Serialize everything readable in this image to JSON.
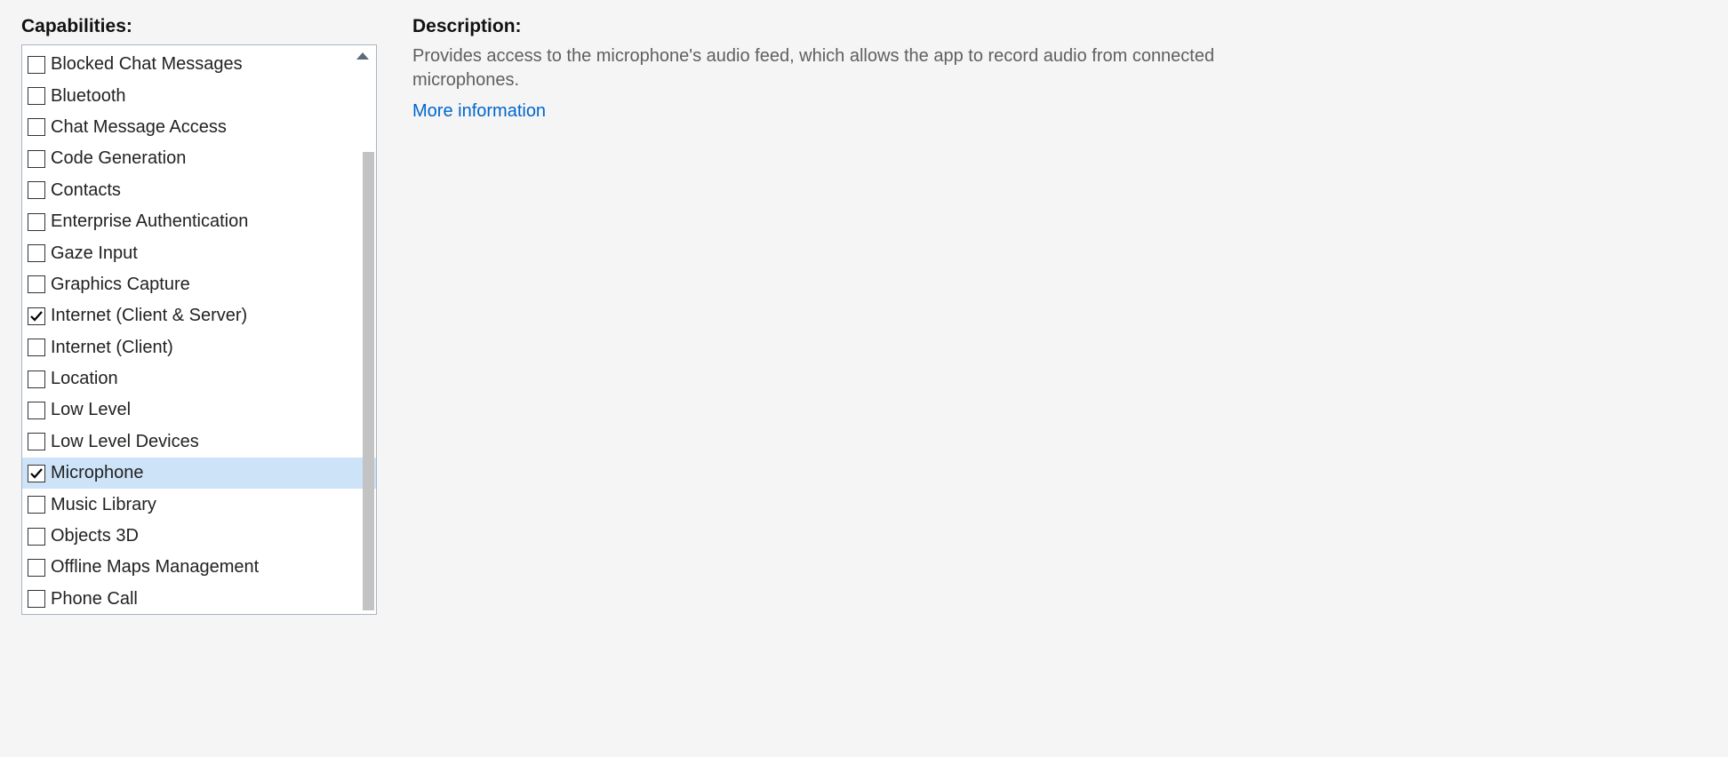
{
  "headings": {
    "capabilities": "Capabilities:",
    "description": "Description:"
  },
  "capabilities": [
    {
      "label": "Blocked Chat Messages",
      "checked": false,
      "selected": false
    },
    {
      "label": "Bluetooth",
      "checked": false,
      "selected": false
    },
    {
      "label": "Chat Message Access",
      "checked": false,
      "selected": false
    },
    {
      "label": "Code Generation",
      "checked": false,
      "selected": false
    },
    {
      "label": "Contacts",
      "checked": false,
      "selected": false
    },
    {
      "label": "Enterprise Authentication",
      "checked": false,
      "selected": false
    },
    {
      "label": "Gaze Input",
      "checked": false,
      "selected": false
    },
    {
      "label": "Graphics Capture",
      "checked": false,
      "selected": false
    },
    {
      "label": "Internet (Client & Server)",
      "checked": true,
      "selected": false
    },
    {
      "label": "Internet (Client)",
      "checked": false,
      "selected": false
    },
    {
      "label": "Location",
      "checked": false,
      "selected": false
    },
    {
      "label": "Low Level",
      "checked": false,
      "selected": false
    },
    {
      "label": "Low Level Devices",
      "checked": false,
      "selected": false
    },
    {
      "label": "Microphone",
      "checked": true,
      "selected": true
    },
    {
      "label": "Music Library",
      "checked": false,
      "selected": false
    },
    {
      "label": "Objects 3D",
      "checked": false,
      "selected": false
    },
    {
      "label": "Offline Maps Management",
      "checked": false,
      "selected": false
    },
    {
      "label": "Phone Call",
      "checked": false,
      "selected": false
    }
  ],
  "description": {
    "text": "Provides access to the microphone's audio feed, which allows the app to record audio from connected microphones.",
    "link": "More information"
  }
}
